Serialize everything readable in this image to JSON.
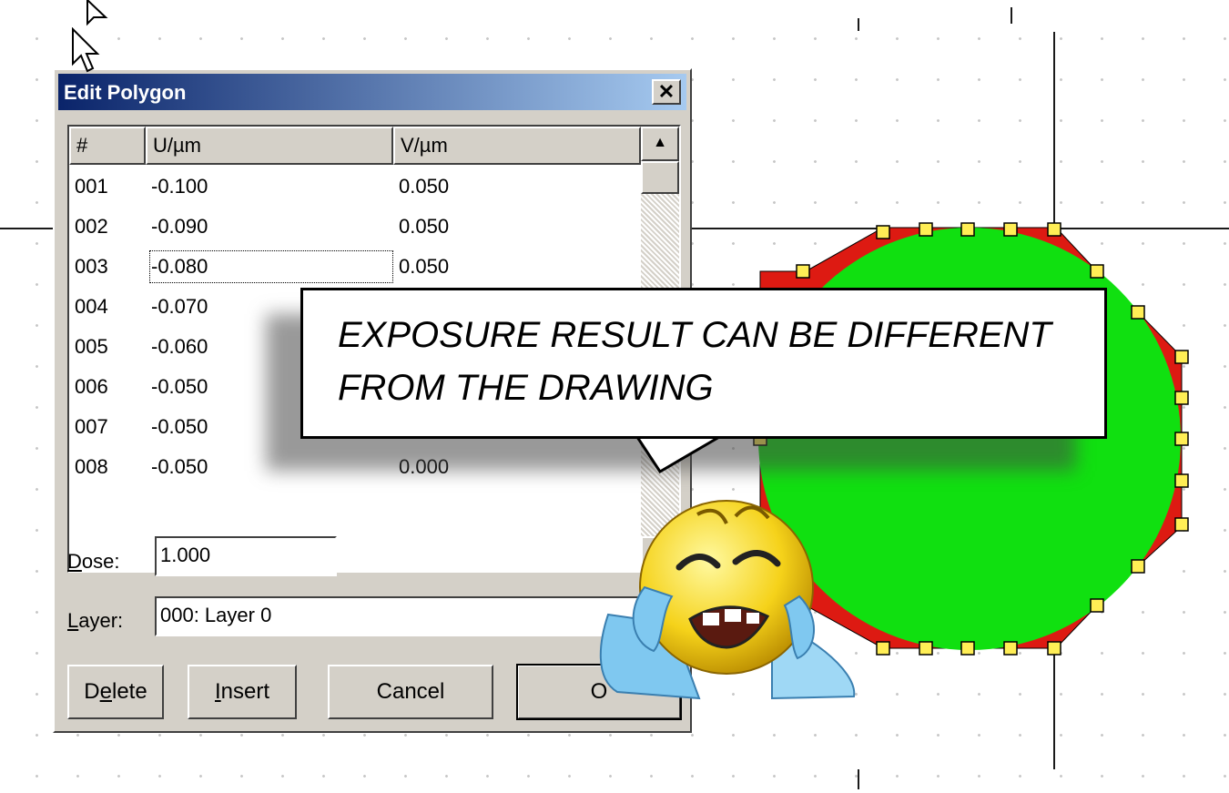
{
  "dialog": {
    "title": "Edit Polygon",
    "close_symbol": "✕",
    "columns": [
      "#",
      "U/µm",
      "V/µm"
    ],
    "rows": [
      {
        "n": "001",
        "u": "-0.100",
        "v": "0.050"
      },
      {
        "n": "002",
        "u": "-0.090",
        "v": "0.050"
      },
      {
        "n": "003",
        "u": "-0.080",
        "v": "0.050"
      },
      {
        "n": "004",
        "u": "-0.070",
        "v": ""
      },
      {
        "n": "005",
        "u": "-0.060",
        "v": ""
      },
      {
        "n": "006",
        "u": "-0.050",
        "v": ""
      },
      {
        "n": "007",
        "u": "-0.050",
        "v": ""
      },
      {
        "n": "008",
        "u": "-0.050",
        "v": "0.000"
      }
    ],
    "dose_label": "Dose:",
    "dose_value": "1.000",
    "layer_label": "Layer:",
    "layer_value": "000: Layer 0",
    "buttons": {
      "delete": "Delete",
      "insert": "Insert",
      "cancel": "Cancel",
      "ok": "O"
    }
  },
  "callout": {
    "line1": "EXPOSURE RESULT CAN BE DIFFERENT",
    "line2": "FROM THE DRAWING"
  },
  "colors": {
    "polygon_fill": "#dd1a12",
    "circle_fill": "#10e010",
    "vertex_handle": "#ffee55",
    "titlebar": "#0a246a"
  },
  "icons": {
    "cursor": "arrow-pointer-icon",
    "emoji": "crying-face-icon"
  }
}
